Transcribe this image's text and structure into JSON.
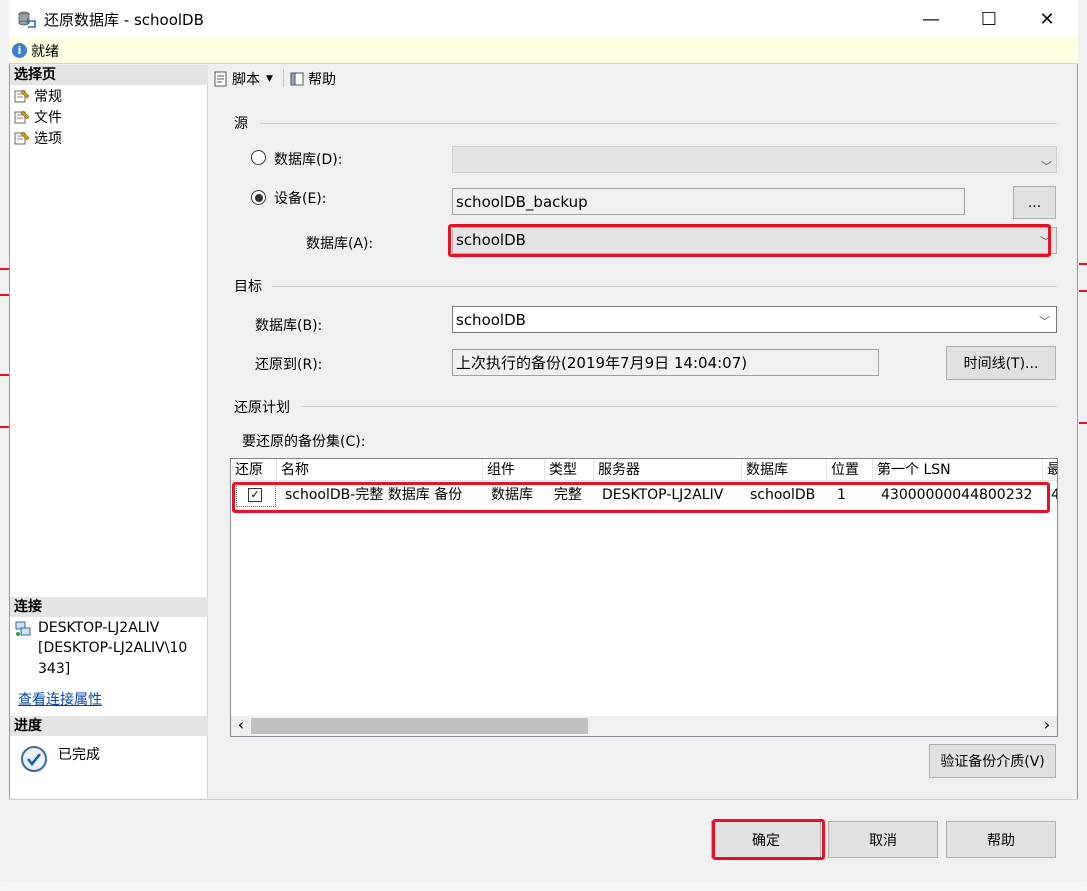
{
  "window": {
    "title": "还原数据库 - schoolDB",
    "minimize": "—",
    "maximize": "☐",
    "close": "✕",
    "app_icon": "database-restore-icon"
  },
  "status": {
    "text": "就绪",
    "icon": "info-icon"
  },
  "left": {
    "select_page_header": "选择页",
    "pages": [
      {
        "label": "常规",
        "icon": "page-wrench-icon"
      },
      {
        "label": "文件",
        "icon": "page-wrench-icon"
      },
      {
        "label": "选项",
        "icon": "page-wrench-icon"
      }
    ],
    "connection_header": "连接",
    "server_line1": "DESKTOP-LJ2ALIV",
    "server_line2": "[DESKTOP-LJ2ALIV\\10",
    "server_line3": "343]",
    "view_connection_link": "查看连接属性",
    "progress_header": "进度",
    "progress_status": "已完成"
  },
  "toolbar": {
    "script_label": "脚本",
    "help_label": "帮助"
  },
  "source": {
    "group_label": "源",
    "database_radio_label": "数据库(D):",
    "device_radio_label": "设备(E):",
    "device_value": "schoolDB_backup",
    "browse_button": "...",
    "database_label": "数据库(A):",
    "database_value": "schoolDB",
    "selected_option": "device"
  },
  "destination": {
    "group_label": "目标",
    "database_label": "数据库(B):",
    "database_value": "schoolDB",
    "restore_to_label": "还原到(R):",
    "restore_to_value": "上次执行的备份(2019年7月9日 14:04:07)",
    "timeline_button": "时间线(T)..."
  },
  "plan": {
    "group_label": "还原计划",
    "backup_sets_label": "要还原的备份集(C):",
    "columns": [
      "还原",
      "名称",
      "组件",
      "类型",
      "服务器",
      "数据库",
      "位置",
      "第一个 LSN",
      "最"
    ],
    "rows": [
      {
        "restore": true,
        "name": "schoolDB-完整 数据库 备份",
        "component": "数据库",
        "type": "完整",
        "server": "DESKTOP-LJ2ALIV",
        "database": "schoolDB",
        "position": "1",
        "first_lsn": "43000000044800232",
        "last": "4"
      }
    ],
    "scroll_left": "‹",
    "scroll_right": "›",
    "verify_button": "验证备份介质(V)"
  },
  "buttons": {
    "ok": "确定",
    "cancel": "取消",
    "help": "帮助"
  },
  "colors": {
    "highlight": "#e81123",
    "link": "#0645ad",
    "status_bg": "#ffffe1"
  }
}
